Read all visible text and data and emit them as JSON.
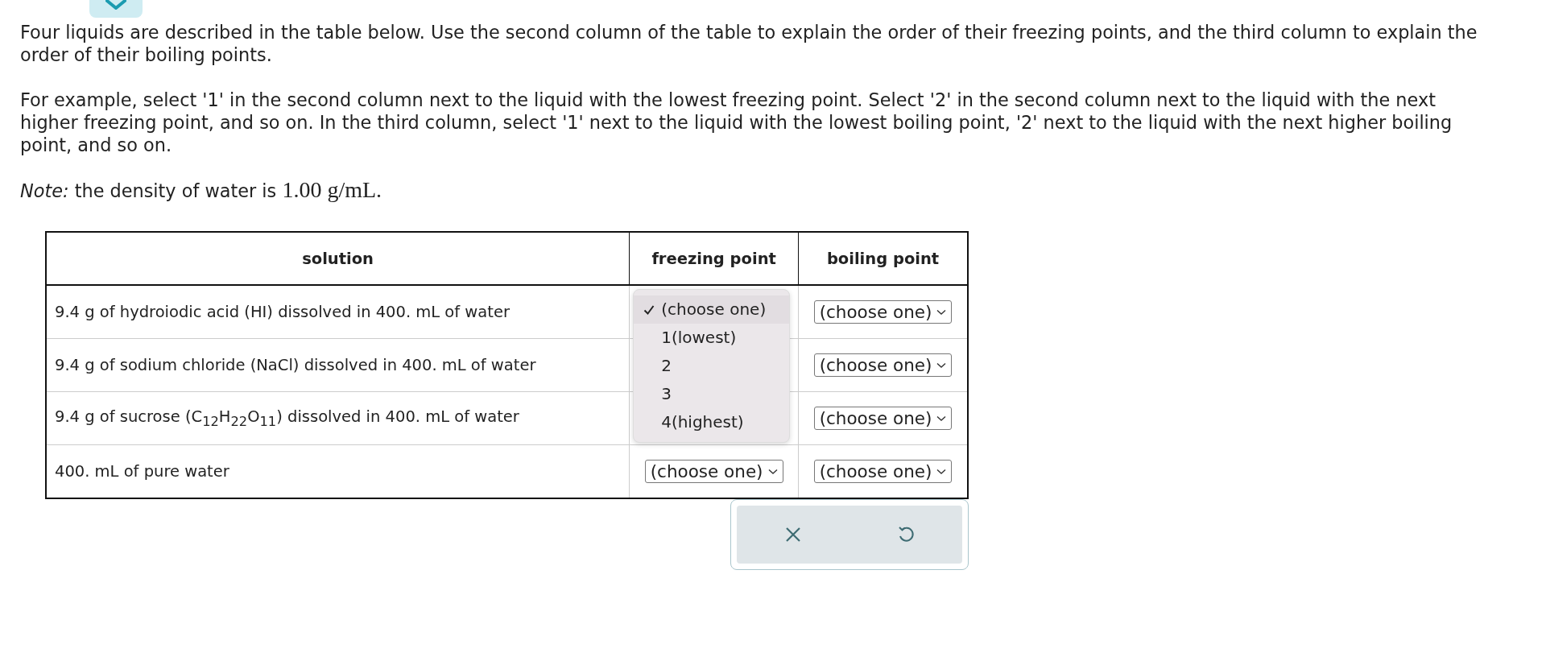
{
  "intro": [
    "Four liquids are described in the table below. Use the second column of the table to explain the order of their freezing points, and the third column to explain the order of their boiling points.",
    "For example, select '1' in the second column next to the liquid with the lowest freezing point. Select '2' in the second column next to the liquid with the next higher freezing point, and so on. In the third column, select '1' next to the liquid with the lowest boiling point, '2' next to the liquid with the next higher boiling point, and so on."
  ],
  "note": {
    "text": "*Note:* the density of water is",
    "value": "1.00 g/mL."
  },
  "table": {
    "columns": [
      "solution",
      "freezing point",
      "boiling point"
    ],
    "rows": [
      {
        "solution": "9.4 g of hydroiodic acid (HI) dissolved in 400. mL of water",
        "boiling": "(choose one)"
      },
      {
        "solution": "9.4 g of sodium chloride (NaCl) dissolved in 400. mL of water",
        "boiling": "(choose one)"
      },
      {
        "solution": "9.4 g of sucrose (C$_{12}$H$_{22}$O$_{11}$) dissolved in 400. mL of water",
        "boiling": "(choose one)"
      },
      {
        "solution": "400. mL of pure water",
        "freezing": "(choose one)",
        "boiling": "(choose one)"
      }
    ],
    "open_menu": {
      "options": [
        {
          "label": "(choose one)",
          "selected": true
        },
        {
          "label": "1(lowest)",
          "selected": false
        },
        {
          "label": "2",
          "selected": false
        },
        {
          "label": "3",
          "selected": false
        },
        {
          "label": "4(highest)",
          "selected": false
        }
      ]
    }
  },
  "actions": [
    {
      "kind": "clear"
    },
    {
      "kind": "undo"
    }
  ]
}
